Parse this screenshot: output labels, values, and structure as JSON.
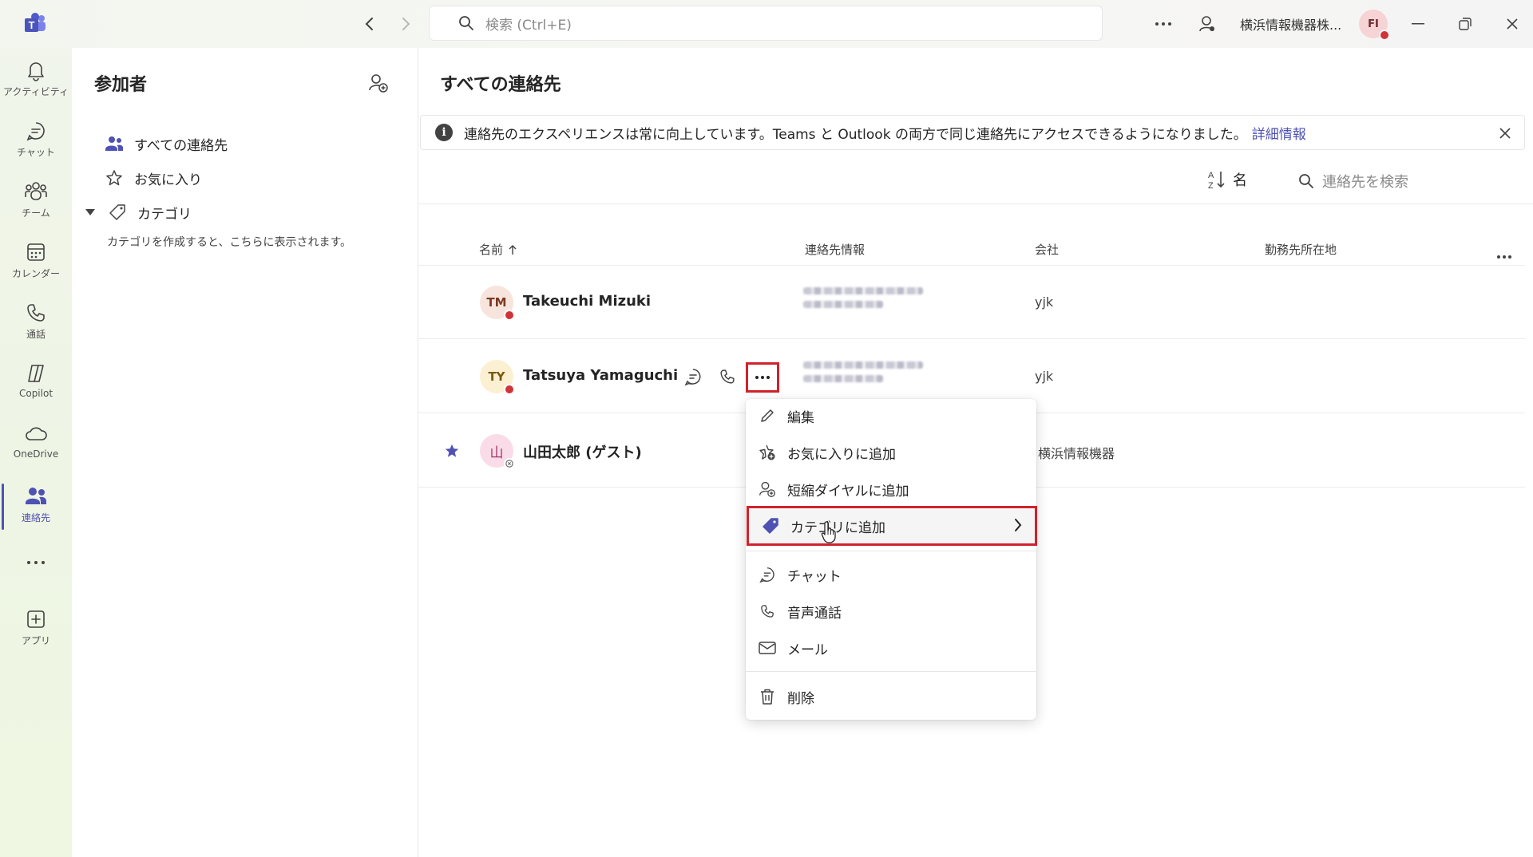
{
  "titlebar": {
    "search_placeholder": "検索 (Ctrl+E)",
    "org_name": "横浜情報機器株...",
    "user_initials": "FI"
  },
  "rail": {
    "items": [
      {
        "label": "アクティビティ",
        "icon": "bell-icon"
      },
      {
        "label": "チャット",
        "icon": "chat-icon"
      },
      {
        "label": "チーム",
        "icon": "teams-icon"
      },
      {
        "label": "カレンダー",
        "icon": "calendar-icon"
      },
      {
        "label": "通話",
        "icon": "phone-icon"
      },
      {
        "label": "Copilot",
        "icon": "copilot-icon"
      },
      {
        "label": "OneDrive",
        "icon": "cloud-icon"
      },
      {
        "label": "連絡先",
        "icon": "people-icon",
        "active": true
      },
      {
        "label": "アプリ",
        "icon": "add-app-icon"
      }
    ]
  },
  "leftpane": {
    "title": "参加者",
    "nav": [
      {
        "label": "すべての連絡先",
        "icon": "people-icon"
      },
      {
        "label": "お気に入り",
        "icon": "star-icon"
      },
      {
        "label": "カテゴリ",
        "icon": "tag-icon"
      }
    ],
    "category_hint": "カテゴリを作成すると、こちらに表示されます。"
  },
  "main": {
    "title": "すべての連絡先",
    "banner": {
      "text": "連絡先のエクスペリエンスは常に向上しています。Teams と Outlook の両方で同じ連絡先にアクセスできるようになりました。",
      "link": "詳細情報"
    },
    "sort_label": "名",
    "search_placeholder": "連絡先を検索",
    "columns": {
      "name": "名前",
      "contact": "連絡先情報",
      "company": "会社",
      "location": "勤務先所在地"
    },
    "contacts": [
      {
        "initials": "TM",
        "name": "Takeuchi Mizuki",
        "company": "yjk",
        "avatar_bg": "#f7e4dc",
        "avatar_fg": "#7a3b22",
        "presence": "#d13438",
        "favorite": false
      },
      {
        "initials": "TY",
        "name": "Tatsuya Yamaguchi",
        "company": "yjk",
        "avatar_bg": "#fbf0d2",
        "avatar_fg": "#7a5a10",
        "presence": "#d13438",
        "favorite": false
      },
      {
        "initials": "山",
        "name": "山田太郎 (ゲスト)",
        "company": "横浜情報機器",
        "avatar_bg": "#fadce8",
        "avatar_fg": "#a23a6a",
        "presence": "#ffffff",
        "favorite": true
      }
    ]
  },
  "context_menu": {
    "items": [
      {
        "label": "編集",
        "icon": "pencil-icon"
      },
      {
        "label": "お気に入りに追加",
        "icon": "star-add-icon"
      },
      {
        "label": "短縮ダイヤルに追加",
        "icon": "person-add-icon"
      },
      {
        "label": "カテゴリに追加",
        "icon": "tag-icon",
        "highlighted": true
      },
      {
        "label": "チャット",
        "icon": "chat-icon"
      },
      {
        "label": "音声通話",
        "icon": "phone-icon"
      },
      {
        "label": "メール",
        "icon": "mail-icon"
      },
      {
        "label": "削除",
        "icon": "trash-icon"
      }
    ]
  },
  "colors": {
    "accent": "#4f52b2",
    "highlight_box": "#d1222c",
    "busy": "#d13438"
  }
}
